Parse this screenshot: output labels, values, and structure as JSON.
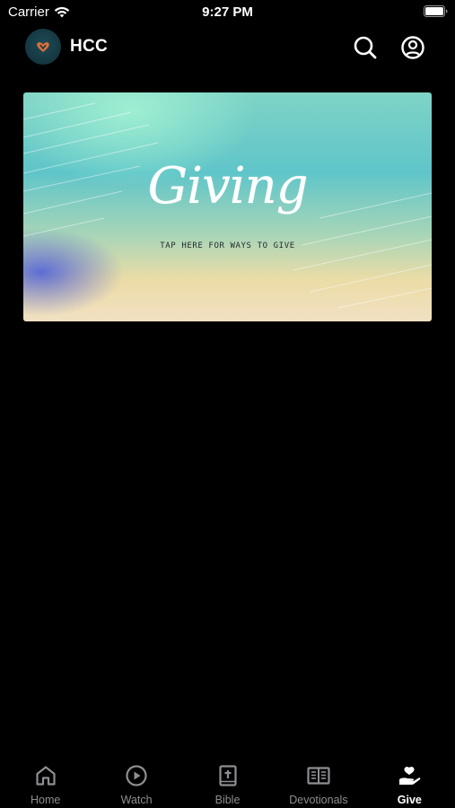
{
  "status_bar": {
    "carrier": "Carrier",
    "time": "9:27 PM"
  },
  "header": {
    "app_name": "HCC",
    "avatar_icon": "hcc-heart-logo",
    "search_icon": "search-icon",
    "profile_icon": "profile-icon"
  },
  "giving_card": {
    "title": "Giving",
    "subtitle": "TAP HERE FOR WAYS TO GIVE"
  },
  "tabs": [
    {
      "label": "Home",
      "icon": "home-icon",
      "active": false
    },
    {
      "label": "Watch",
      "icon": "play-circle-icon",
      "active": false
    },
    {
      "label": "Bible",
      "icon": "bible-icon",
      "active": false
    },
    {
      "label": "Devotionals",
      "icon": "open-book-icon",
      "active": false
    },
    {
      "label": "Give",
      "icon": "give-hand-icon",
      "active": true
    }
  ],
  "colors": {
    "background": "#000000",
    "tab_inactive": "#8e8e93",
    "tab_active": "#ffffff",
    "avatar_bg": "#163a44",
    "logo_accent": "#e0703a"
  }
}
